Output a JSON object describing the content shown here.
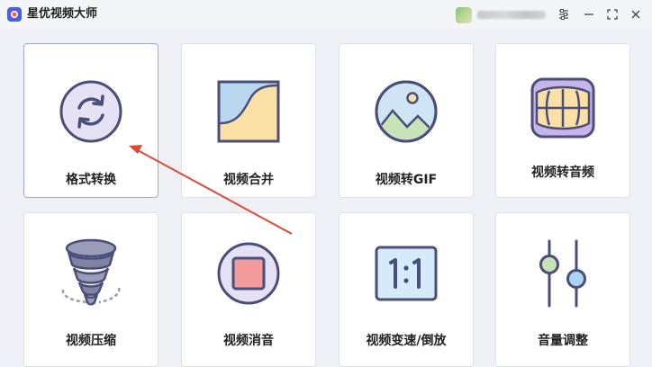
{
  "window": {
    "title": "星优视频大师"
  },
  "titlebar_buttons": {
    "settings": "settings-icon",
    "minimize": "minimize-icon",
    "maximize": "maximize-icon",
    "close": "close-icon"
  },
  "tools": [
    {
      "label": "格式转换",
      "icon": "convert-icon",
      "selected": true
    },
    {
      "label": "视频合并",
      "icon": "merge-icon"
    },
    {
      "label": "视频转GIF",
      "icon": "gif-image-icon"
    },
    {
      "label": "视频转音频",
      "icon": "audio-waveform-icon"
    },
    {
      "label": "视频压缩",
      "icon": "tornado-compress-icon"
    },
    {
      "label": "视频消音",
      "icon": "mute-stop-icon"
    },
    {
      "label": "视频变速/倒放",
      "icon": "speed-ratio-icon"
    },
    {
      "label": "音量调整",
      "icon": "volume-sliders-icon"
    }
  ],
  "colors": {
    "accent": "#6b6fd3",
    "arrow": "#d94a3b",
    "card_border_selected": "#9aa9e6",
    "icon_fill": "#e6e2f5",
    "icon_stroke": "#4a4f7a"
  }
}
